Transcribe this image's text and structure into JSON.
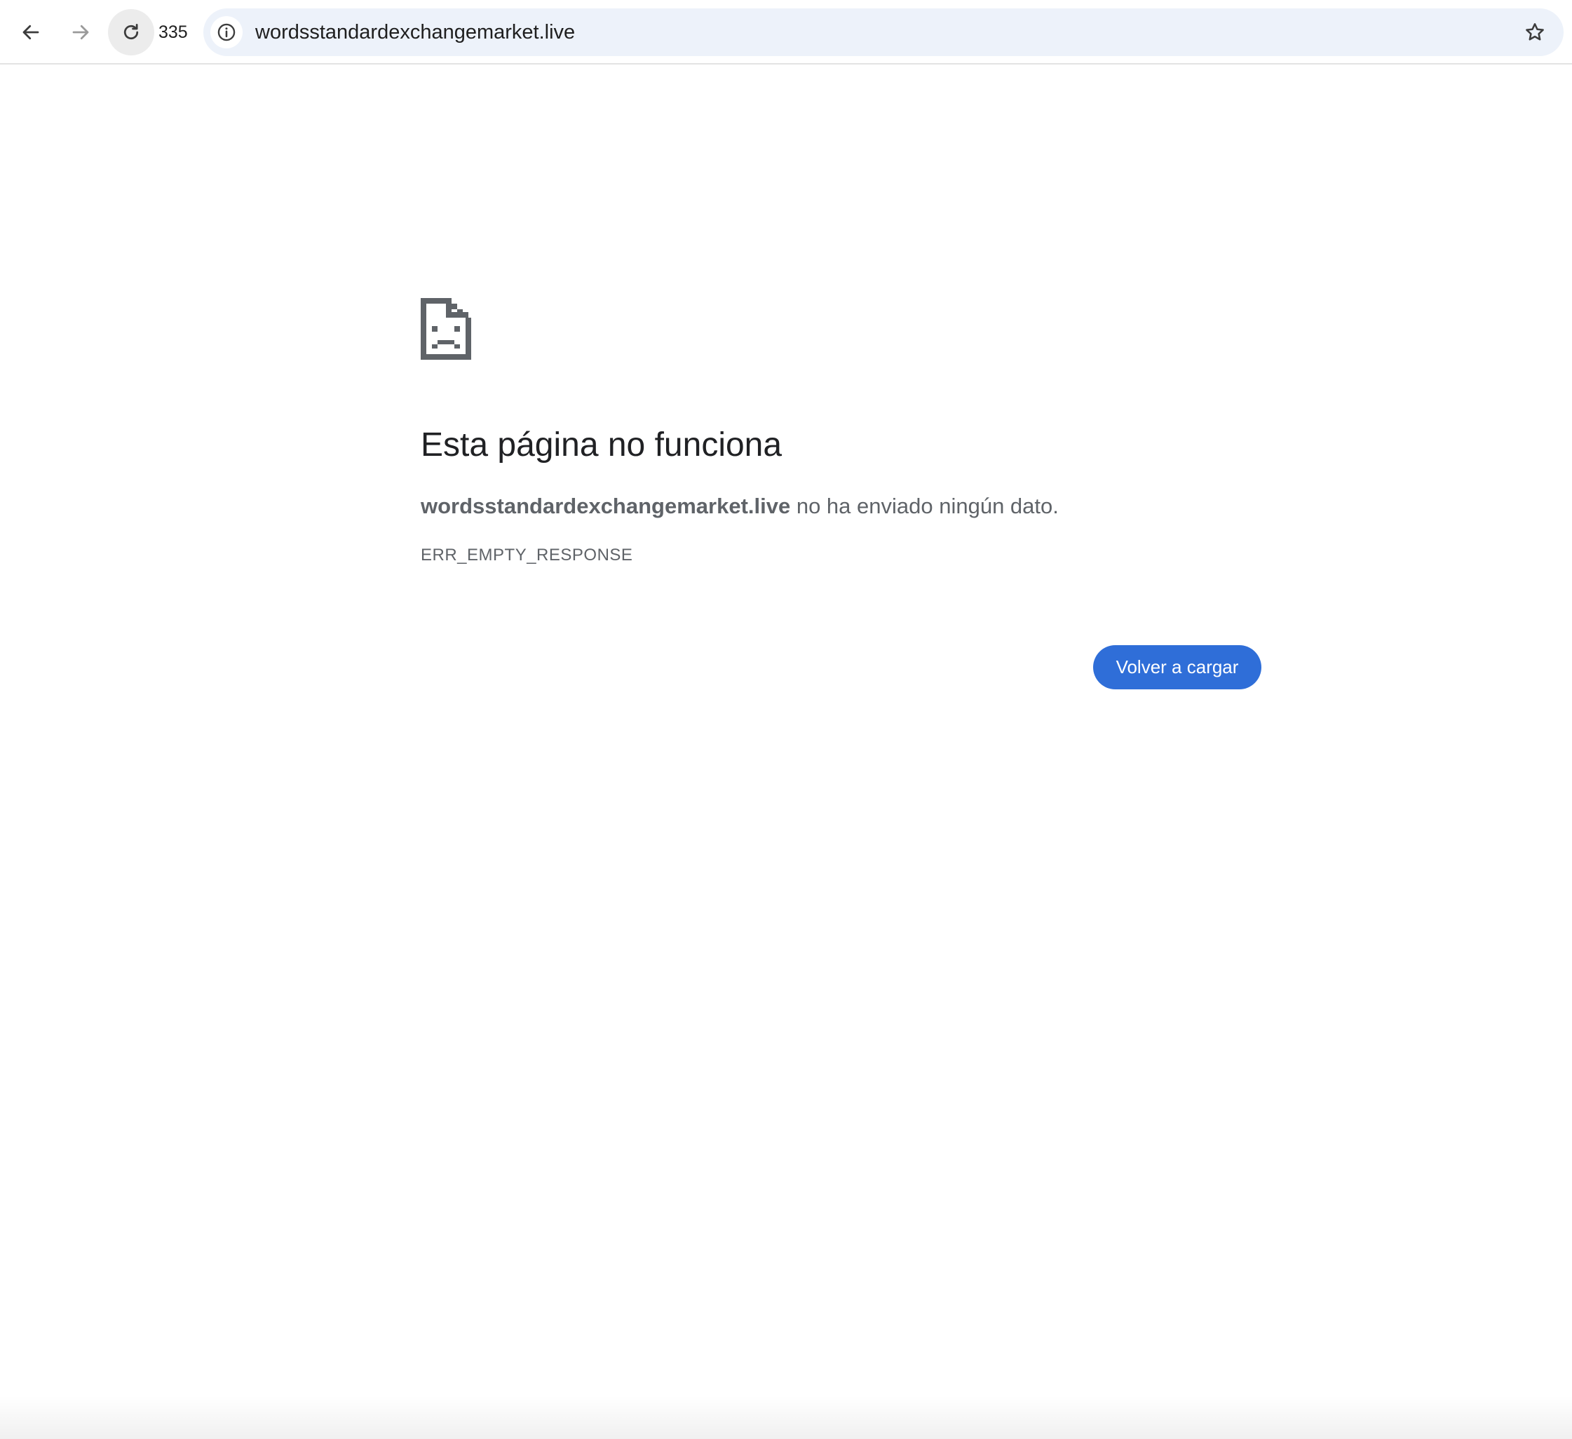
{
  "browser": {
    "reload_count": "335",
    "url": "wordsstandardexchangemarket.live",
    "icons": {
      "back": "back-arrow-icon",
      "forward": "forward-arrow-icon",
      "reload": "reload-icon",
      "site_info": "info-icon",
      "bookmark": "star-icon"
    }
  },
  "error_page": {
    "icon": "sad-page-icon",
    "title": "Esta página no funciona",
    "host": "wordsstandardexchangemarket.live",
    "description_suffix": " no ha enviado ningún dato.",
    "error_code": "ERR_EMPTY_RESPONSE",
    "reload_button_label": "Volver a cargar",
    "accent_color": "#2f6ed8"
  }
}
